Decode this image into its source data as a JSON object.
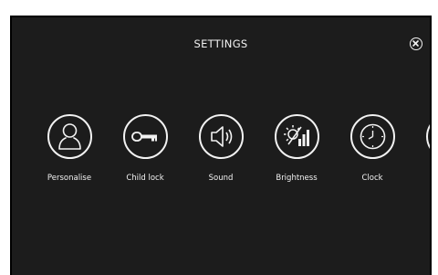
{
  "header": {
    "title": "SETTINGS"
  },
  "close_icon": "close-icon",
  "items": [
    {
      "label": "Personalise",
      "icon": "person-icon"
    },
    {
      "label": "Child lock",
      "icon": "key-icon"
    },
    {
      "label": "Sound",
      "icon": "speaker-icon"
    },
    {
      "label": "Brightness",
      "icon": "brightness-icon"
    },
    {
      "label": "Clock",
      "icon": "clock-icon"
    },
    {
      "label": "",
      "icon": "partial-icon"
    }
  ],
  "colors": {
    "background": "#1c1c1c",
    "foreground": "#f2f2f2"
  }
}
